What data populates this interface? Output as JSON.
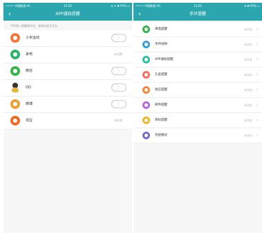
{
  "left": {
    "status_bar": {
      "carrier": "••••• 中国联通 4G",
      "time": "15:26",
      "right": "⊕ ✈ ✱ 95% ▭"
    },
    "title": "APP通知提醒",
    "back_glyph": "‹",
    "hint": "手环通一提醒事件时，请保持蓝牙开启",
    "items": [
      {
        "label": "小米运动",
        "control": "toggle",
        "icon": "mi-sport-icon",
        "color": "#f07a3c"
      },
      {
        "label": "来电",
        "control": "value",
        "value": "未设置",
        "icon": "call-app-icon",
        "color": "#2fb36a"
      },
      {
        "label": "微信",
        "control": "toggle",
        "icon": "wechat-icon",
        "color": "#39b34a"
      },
      {
        "label": "QQ",
        "control": "toggle",
        "icon": "qq-penguin-icon",
        "color": "#333333"
      },
      {
        "label": "微博",
        "control": "toggle",
        "icon": "weibo-icon",
        "color": "#e9a23b"
      },
      {
        "label": "淘宝",
        "control": "value",
        "value": "未安装",
        "icon": "taobao-icon",
        "color": "#f06a2a"
      }
    ]
  },
  "right": {
    "status_bar": {
      "carrier": "••••• 中国联通 4G",
      "time": "15:26",
      "right": "⊕ ✱ 95% ▭"
    },
    "title": "手环提醒",
    "back_glyph": "‹",
    "items": [
      {
        "label": "来电提醒",
        "value": "未开启",
        "chev": "›",
        "icon": "phone-icon",
        "color": "#37b34a"
      },
      {
        "label": "手环闹钟",
        "value": "未开启",
        "chev": "›",
        "icon": "alarm-icon",
        "color": "#3a9de0"
      },
      {
        "label": "APP通知提醒",
        "value": "未开启",
        "chev": "›",
        "icon": "app-notification-icon",
        "color": "#2bbfa6"
      },
      {
        "label": "久坐提醒",
        "value": "未开启",
        "chev": "›",
        "icon": "sedentary-icon",
        "color": "#f07060"
      },
      {
        "label": "短信提醒",
        "value": "未开启",
        "chev": "›",
        "icon": "sms-icon",
        "color": "#f0883c"
      },
      {
        "label": "邮件提醒",
        "value": "未开启",
        "chev": "›",
        "icon": "email-icon",
        "color": "#b76ad6"
      },
      {
        "label": "目标提醒",
        "value": "未开启",
        "chev": "›",
        "icon": "goal-icon",
        "color": "#f0b52a"
      },
      {
        "label": "勿扰模式",
        "value": "未开启",
        "chev": "›",
        "icon": "do-not-disturb-icon",
        "color": "#7d6bc9"
      }
    ]
  }
}
